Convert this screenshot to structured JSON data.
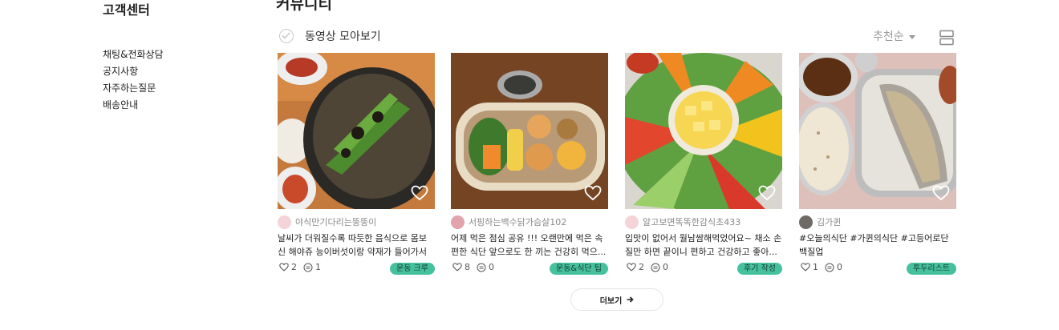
{
  "sidebar": {
    "title": "고객센터",
    "items": [
      {
        "label": "채팅&전화상담"
      },
      {
        "label": "공지사항"
      },
      {
        "label": "자주하는질문"
      },
      {
        "label": "배송안내"
      }
    ]
  },
  "main": {
    "title": "커뮤니티",
    "filter_label": "동영상 모아보기",
    "sort_label": "추천순",
    "more_label": "더보기"
  },
  "cards": [
    {
      "author": "야식만기다리는뚱뚱이",
      "desc": "날씨가 더워질수록 따듯한 음식으로 몸보신 해야쥬 능이버섯이랑 약재가 들어가서 완...",
      "likes": "2",
      "comments": "1",
      "tag": "운동 크루",
      "avatar_color": "#f4d4d8"
    },
    {
      "author": "서핑하는백수닭가슴살102",
      "desc": "어제 먹은 점심 공유 !!! 오랜만에 먹은 속 편한 식단 앞으로도 한 끼는 건강히 먹으...",
      "likes": "8",
      "comments": "0",
      "tag": "운동&식단 팁",
      "avatar_color": "#e3a3ad"
    },
    {
      "author": "알고보면똑똑한감식초433",
      "desc": "입맛이 없어서 월남쌈해먹었어요~ 채소 손질만 하면 끝이니 편하고 건강하고 좋아...",
      "likes": "2",
      "comments": "0",
      "tag": "후기 작성",
      "avatar_color": "#f4d4d8"
    },
    {
      "author": "김가퀸",
      "desc": "#오늘의식단 #가퀸의식단 #고등어로단백질업",
      "likes": "1",
      "comments": "0",
      "tag": "투두리스트",
      "avatar_color": "#6f6a66"
    }
  ],
  "colors": {
    "tag_bg": "#46c19e"
  }
}
